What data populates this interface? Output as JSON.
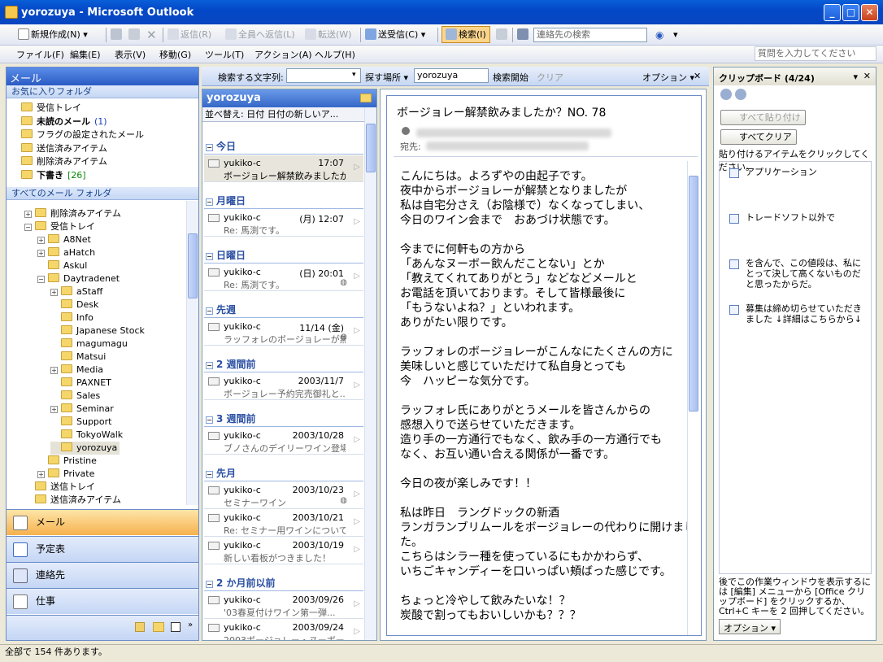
{
  "window": {
    "title": "yorozuya - Microsoft Outlook",
    "minimize": "_",
    "maximize": "□",
    "close": "✕"
  },
  "toolbar1": {
    "new": "新規作成(N)",
    "reply": "返信(R)",
    "reply_all": "全員へ返信(L)",
    "forward": "転送(W)",
    "send_receive": "送受信(C)",
    "find": "検索(I)",
    "address_book": "連絡先の検索"
  },
  "menubar": {
    "items": [
      "ファイル(F)",
      "編集(E)",
      "表示(V)",
      "移動(G)",
      "ツール(T)",
      "アクション(A)",
      "ヘルプ(H)"
    ],
    "help_placeholder": "質問を入力してください"
  },
  "nav": {
    "header": "メール",
    "favorites_header": "お気に入りフォルダ",
    "favorites": [
      {
        "label": "受信トレイ",
        "bold": false,
        "count": ""
      },
      {
        "label": "未読のメール",
        "bold": true,
        "count": "(1)"
      },
      {
        "label": "フラグの設定されたメール",
        "bold": false,
        "count": ""
      },
      {
        "label": "送信済みアイテム",
        "bold": false,
        "count": ""
      },
      {
        "label": "削除済みアイテム",
        "bold": false,
        "count": ""
      },
      {
        "label": "下書き",
        "bold": true,
        "count": "[26]"
      }
    ],
    "all_header": "すべてのメール フォルダ",
    "tree": [
      {
        "label": "削除済みアイテム",
        "indent": 1,
        "exp": "+"
      },
      {
        "label": "受信トレイ",
        "indent": 1,
        "exp": "-"
      },
      {
        "label": "A8Net",
        "indent": 2,
        "exp": "+"
      },
      {
        "label": "aHatch",
        "indent": 2,
        "exp": "+"
      },
      {
        "label": "Askul",
        "indent": 2,
        "exp": ""
      },
      {
        "label": "Daytradenet",
        "indent": 2,
        "exp": "-"
      },
      {
        "label": "aStaff",
        "indent": 3,
        "exp": "+"
      },
      {
        "label": "Desk",
        "indent": 3,
        "exp": ""
      },
      {
        "label": "Info",
        "indent": 3,
        "exp": ""
      },
      {
        "label": "Japanese Stock",
        "indent": 3,
        "exp": ""
      },
      {
        "label": "magumagu",
        "indent": 3,
        "exp": ""
      },
      {
        "label": "Matsui",
        "indent": 3,
        "exp": ""
      },
      {
        "label": "Media",
        "indent": 3,
        "exp": "+"
      },
      {
        "label": "PAXNET",
        "indent": 3,
        "exp": ""
      },
      {
        "label": "Sales",
        "indent": 3,
        "exp": ""
      },
      {
        "label": "Seminar",
        "indent": 3,
        "exp": "+"
      },
      {
        "label": "Support",
        "indent": 3,
        "exp": ""
      },
      {
        "label": "TokyoWalk",
        "indent": 3,
        "exp": ""
      },
      {
        "label": "yorozuya",
        "indent": 3,
        "exp": ""
      },
      {
        "label": "Pristine",
        "indent": 2,
        "exp": ""
      },
      {
        "label": "Private",
        "indent": 2,
        "exp": "+"
      },
      {
        "label": "送信トレイ",
        "indent": 1,
        "exp": ""
      },
      {
        "label": "送信済みアイテム",
        "indent": 1,
        "exp": ""
      }
    ],
    "buttons": [
      "メール",
      "予定表",
      "連絡先",
      "仕事"
    ]
  },
  "findbar": {
    "search_label": "検索する文字列:",
    "search_value": "",
    "location_label": "探す場所 ▾",
    "location_value": "yorozuya",
    "start": "検索開始",
    "clear": "クリア",
    "options": "オプション ▾",
    "close": "✕"
  },
  "mail_list": {
    "folder": "yorozuya",
    "sort": "並べ替え: 日付  日付の新しいア...",
    "groups": [
      {
        "label": "今日",
        "messages": [
          {
            "from": "yukiko-c",
            "date": "17:07",
            "subject": "ボージョレー解禁飲みましたか",
            "selected": true,
            "clip": false
          }
        ]
      },
      {
        "label": "月曜日",
        "messages": [
          {
            "from": "yukiko-c",
            "date": "(月) 12:07",
            "subject": "Re: 馬渕です。",
            "selected": false,
            "clip": false
          }
        ]
      },
      {
        "label": "日曜日",
        "messages": [
          {
            "from": "yukiko-c",
            "date": "(日) 20:01",
            "subject": "Re: 馬渕です。",
            "selected": false,
            "clip": true
          }
        ]
      },
      {
        "label": "先週",
        "messages": [
          {
            "from": "yukiko-c",
            "date": "11/14 (金)",
            "subject": "ラッフォレのボージョレーが無...",
            "selected": false,
            "clip": true
          }
        ]
      },
      {
        "label": "2 週間前",
        "messages": [
          {
            "from": "yukiko-c",
            "date": "2003/11/7",
            "subject": "ボージョレー予約完売御礼と...",
            "selected": false,
            "clip": false
          }
        ]
      },
      {
        "label": "3 週間前",
        "messages": [
          {
            "from": "yukiko-c",
            "date": "2003/10/28",
            "subject": "ブノさんのデイリーワイン登場！...",
            "selected": false,
            "clip": false
          }
        ]
      },
      {
        "label": "先月",
        "messages": [
          {
            "from": "yukiko-c",
            "date": "2003/10/23",
            "subject": "セミナーワイン",
            "selected": false,
            "clip": true
          },
          {
            "from": "yukiko-c",
            "date": "2003/10/21",
            "subject": "Re: セミナー用ワインについて・・",
            "selected": false,
            "clip": false
          },
          {
            "from": "yukiko-c",
            "date": "2003/10/19",
            "subject": "新しい看板がつきました！",
            "selected": false,
            "clip": false
          }
        ]
      },
      {
        "label": "2 か月前以前",
        "messages": [
          {
            "from": "yukiko-c",
            "date": "2003/09/26",
            "subject": "'03春夏付けワイン第一弾...",
            "selected": false,
            "clip": false
          },
          {
            "from": "yukiko-c",
            "date": "2003/09/24",
            "subject": "2003ボージョレー・ヌーボー",
            "selected": false,
            "clip": false
          }
        ]
      }
    ]
  },
  "reading": {
    "subject": "ボージョレー解禁飲みましたか？NO. 78",
    "to_label": "宛先:",
    "body": [
      "こんにちは。よろずやの由起子です。",
      "夜中からボージョレーが解禁となりましたが",
      "私は自宅分さえ（お陰様で）なくなってしまい、",
      "今日のワイン会まで　おあづけ状態です。",
      "",
      "今までに何軒もの方から",
      "「あんなヌーボー飲んだことない」とか",
      "「教えてくれてありがとう」などなどメールと",
      "お電話を頂いております。そして皆様最後に",
      "「もうないよね？」といわれます。",
      "ありがたい限りです。",
      "",
      "ラッフォレのボージョレーがこんなにたくさんの方に",
      "美味しいと感じていただけて私自身とっても",
      "今　ハッピーな気分です。",
      "",
      "ラッフォレ氏にありがとうメールを皆さんからの",
      "感想入りで送らせていただきます。",
      "造り手の一方通行でもなく、飲み手の一方通行でも",
      "なく、お互い通い合える関係が一番です。",
      "",
      "今日の夜が楽しみです！！",
      "",
      "私は昨日　ラングドックの新酒",
      "ランガランブリムールをボージョレーの代わりに開けまし",
      "た。",
      "こちらはシラー種を使っているにもかかわらず、",
      "いちごキャンディーを口いっぱい頬ばった感じです。",
      "",
      "ちょっと冷やして飲みたいな！？",
      "炭酸で割ってもおいしいかも？？？"
    ]
  },
  "clipboard": {
    "title": "クリップボード (4/24)",
    "paste_all": "すべて貼り付け",
    "clear_all": "すべてクリア",
    "instruction": "貼り付けるアイテムをクリックしてください。",
    "items": [
      "アプリケーション",
      "トレードソフト以外で",
      "を含んで、この値段は、私にとって決して高くないものだと思ったからだ。",
      "募集は締め切らせていただきました ↓詳細はこちらから↓"
    ],
    "footer": "後でこの作業ウィンドウを表示するには [編集] メニューから [Office クリップボード] をクリックするか、Ctrl+C キーを 2 回押してください。",
    "options": "オプション ▾"
  },
  "status": {
    "text": "全部で 154 件あります。"
  }
}
